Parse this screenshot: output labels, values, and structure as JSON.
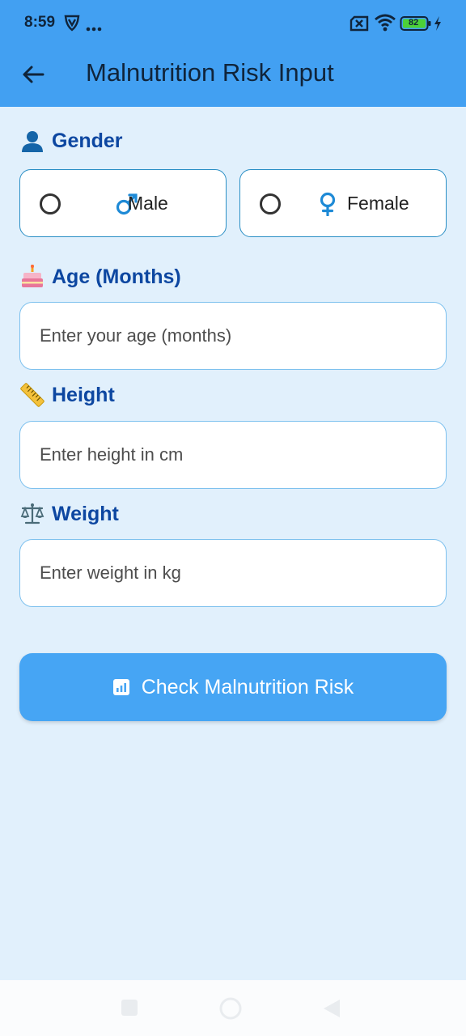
{
  "status_bar": {
    "time": "8:59",
    "battery_level": "82",
    "icons": [
      "vpn-shield-icon",
      "more-dots-icon",
      "sim-off-icon",
      "wifi-icon",
      "battery-icon",
      "charging-icon"
    ]
  },
  "app_bar": {
    "title": "Malnutrition Risk Input",
    "back_icon": "arrow-left-icon",
    "background": "#42a0f2"
  },
  "gender": {
    "label": "Gender",
    "emoji": "person-icon",
    "options": [
      {
        "label": "Male",
        "icon": "male-symbol-icon",
        "selected": false
      },
      {
        "label": "Female",
        "icon": "female-symbol-icon",
        "selected": false
      }
    ]
  },
  "age": {
    "label": "Age (Months)",
    "emoji": "cake-icon",
    "placeholder": "Enter your age (months)",
    "value": ""
  },
  "height": {
    "label": "Height",
    "emoji": "ruler-icon",
    "placeholder": "Enter height in cm",
    "value": ""
  },
  "weight": {
    "label": "Weight",
    "emoji": "scale-icon",
    "placeholder": "Enter weight in kg",
    "value": ""
  },
  "submit": {
    "label": "Check Malnutrition Risk",
    "icon": "chart-icon",
    "color": "#46a5f4"
  },
  "nav_bar": {
    "buttons": [
      "recents-button",
      "home-button",
      "back-button"
    ]
  },
  "colors": {
    "page_background": "#e1f0fc",
    "label_text": "#0d47a1",
    "card_border": "#2b8fc5"
  }
}
